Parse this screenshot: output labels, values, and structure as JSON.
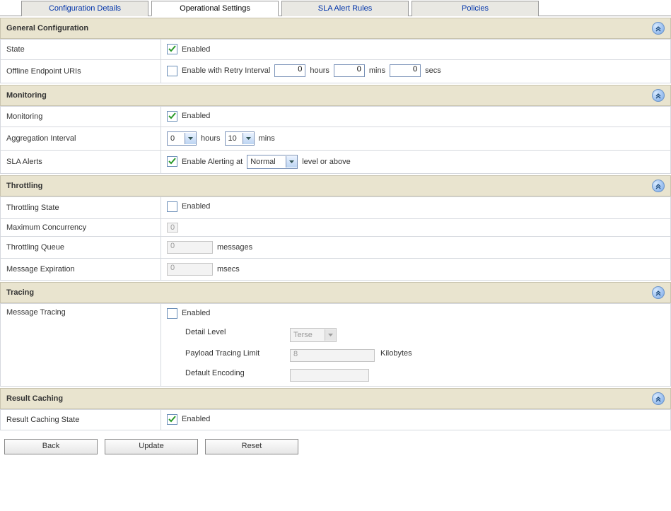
{
  "tabs": {
    "config": "Configuration Details",
    "operational": "Operational Settings",
    "sla": "SLA Alert Rules",
    "policies": "Policies"
  },
  "sections": {
    "general": {
      "title": "General Configuration",
      "state_label": "State",
      "state_enabled_text": "Enabled",
      "offline_label": "Offline Endpoint URIs",
      "offline_text": "Enable with Retry Interval",
      "hours_val": "0",
      "hours_unit": "hours",
      "mins_val": "0",
      "mins_unit": "mins",
      "secs_val": "0",
      "secs_unit": "secs"
    },
    "monitoring": {
      "title": "Monitoring",
      "monitoring_label": "Monitoring",
      "monitoring_enabled_text": "Enabled",
      "agg_label": "Aggregation Interval",
      "agg_hours_val": "0",
      "agg_hours_unit": "hours",
      "agg_mins_val": "10",
      "agg_mins_unit": "mins",
      "sla_label": "SLA Alerts",
      "sla_text_pre": "Enable Alerting at",
      "sla_level": "Normal",
      "sla_text_post": "level or above"
    },
    "throttling": {
      "title": "Throttling",
      "state_label": "Throttling State",
      "state_text": "Enabled",
      "max_label": "Maximum Concurrency",
      "max_val": "0",
      "queue_label": "Throttling Queue",
      "queue_val": "0",
      "queue_unit": "messages",
      "exp_label": "Message Expiration",
      "exp_val": "0",
      "exp_unit": "msecs"
    },
    "tracing": {
      "title": "Tracing",
      "msg_label": "Message Tracing",
      "msg_text": "Enabled",
      "detail_label": "Detail Level",
      "detail_val": "Terse",
      "payload_label": "Payload Tracing Limit",
      "payload_val": "8",
      "payload_unit": "Kilobytes",
      "enc_label": "Default Encoding"
    },
    "result": {
      "title": "Result Caching",
      "state_label": "Result Caching State",
      "state_text": "Enabled"
    }
  },
  "buttons": {
    "back": "Back",
    "update": "Update",
    "reset": "Reset"
  }
}
